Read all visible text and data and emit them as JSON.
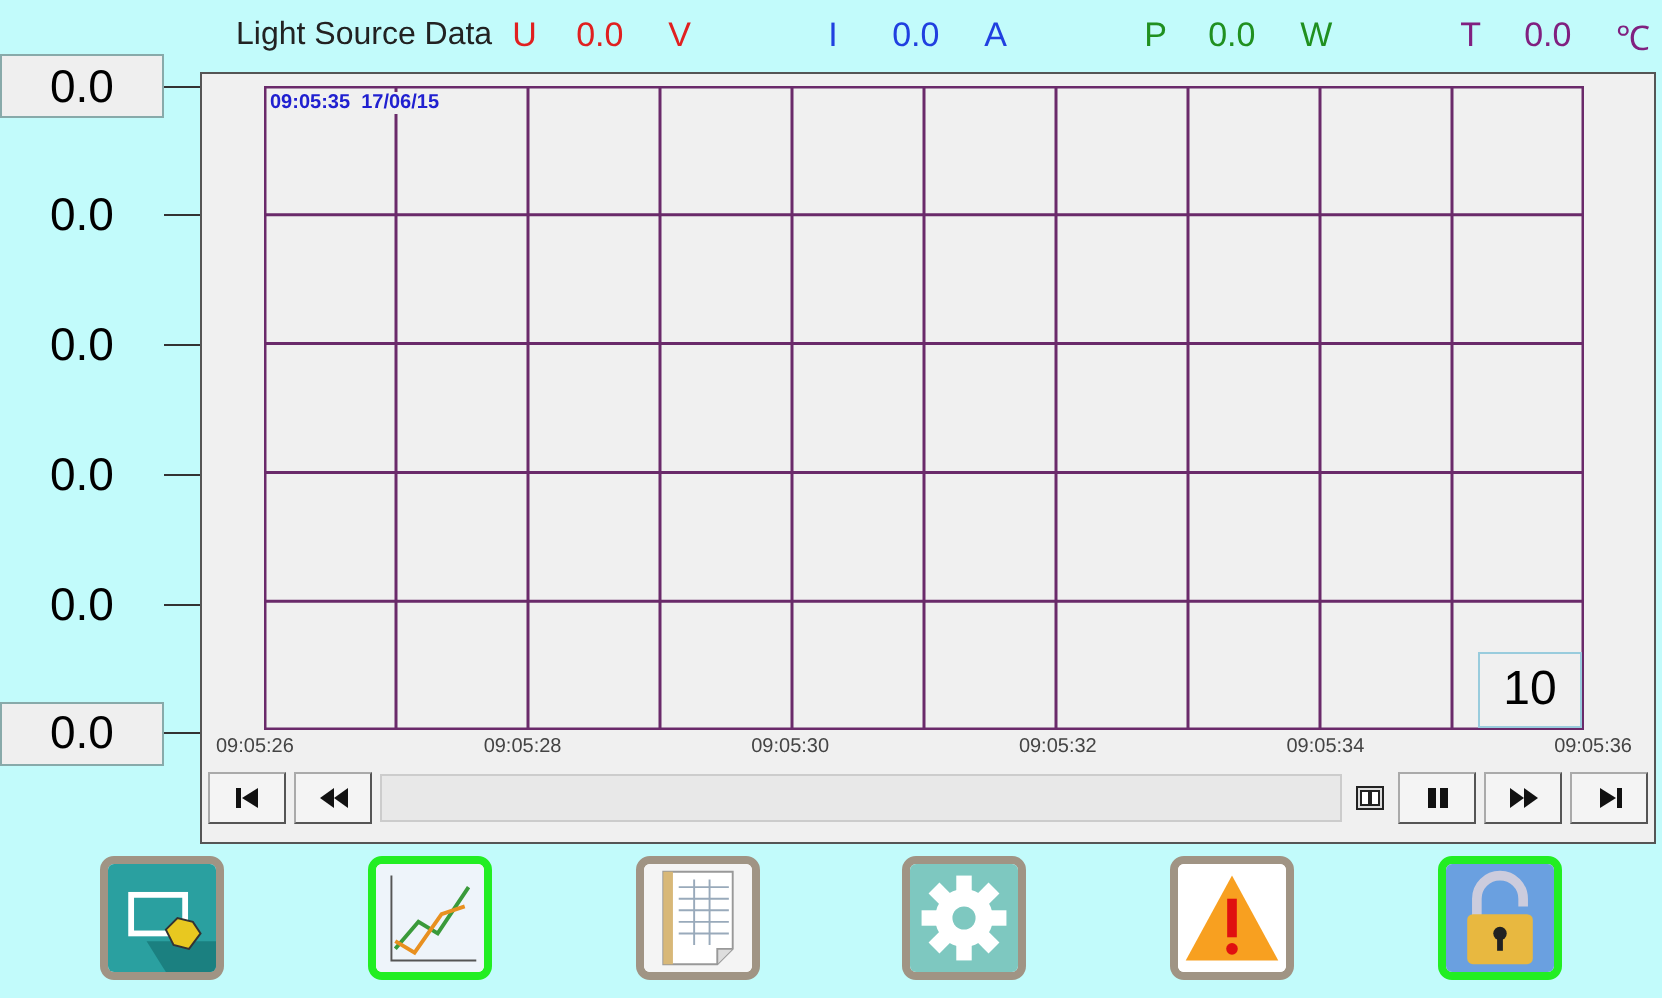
{
  "title": "Light Source Data",
  "readings": [
    {
      "symbol": "U",
      "value": "0.0",
      "unit": "V",
      "color": "#e02020"
    },
    {
      "symbol": "I",
      "value": "0.0",
      "unit": "A",
      "color": "#2040e0"
    },
    {
      "symbol": "P",
      "value": "0.0",
      "unit": "W",
      "color": "#209020"
    },
    {
      "symbol": "T",
      "value": "0.0",
      "unit": "℃",
      "color": "#802080"
    }
  ],
  "y_axis": [
    {
      "label": "0.0",
      "kind": "field"
    },
    {
      "label": "0.0",
      "kind": "tick"
    },
    {
      "label": "0.0",
      "kind": "tick"
    },
    {
      "label": "0.0",
      "kind": "tick"
    },
    {
      "label": "0.0",
      "kind": "tick"
    },
    {
      "label": "0.0",
      "kind": "field"
    }
  ],
  "timestamp": "09:05:35  17/06/15",
  "span": "10",
  "x_axis": [
    "09:05:26",
    "09:05:28",
    "09:05:30",
    "09:05:32",
    "09:05:34",
    "09:05:36"
  ],
  "controls": [
    {
      "kind": "first"
    },
    {
      "kind": "rewind"
    },
    {
      "kind": "track"
    },
    {
      "kind": "window"
    },
    {
      "kind": "pause"
    },
    {
      "kind": "forward"
    },
    {
      "kind": "last"
    }
  ],
  "toolbar": [
    {
      "kind": "screen",
      "selected": false
    },
    {
      "kind": "chart",
      "selected": true
    },
    {
      "kind": "sheet",
      "selected": false
    },
    {
      "kind": "settings",
      "selected": false
    },
    {
      "kind": "alarm",
      "selected": false
    },
    {
      "kind": "lock",
      "selected": true
    }
  ]
}
